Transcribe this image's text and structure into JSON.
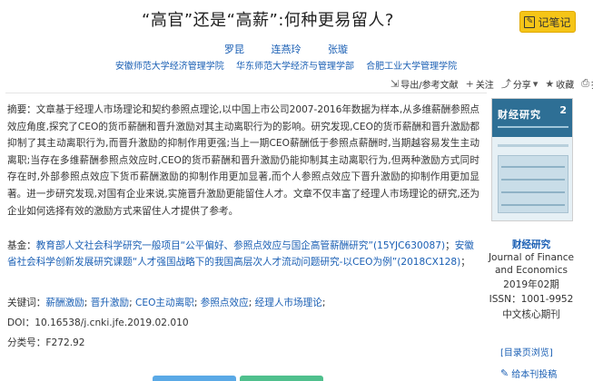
{
  "title": "“高官”还是“高薪”:何种更易留人?",
  "note_button": {
    "label": "记笔记",
    "icon": "notebook-icon"
  },
  "authors": [
    "罗昆",
    "连燕玲",
    "张璇"
  ],
  "orgs": [
    "安徽师范大学经济管理学院",
    "华东师范大学经济与管理学部",
    "合肥工业大学管理学院"
  ],
  "toolbar": {
    "export": "导出/参考文献",
    "follow": "关注",
    "share": "分享",
    "favorite": "收藏",
    "print": "打印"
  },
  "abstract": {
    "label": "摘要：",
    "text": "文章基于经理人市场理论和契约参照点理论,以中国上市公司2007-2016年数据为样本,从多维薪酬参照点效应角度,探究了CEO的货币薪酬和晋升激励对其主动离职行为的影响。研究发现,CEO的货币薪酬和晋升激励都抑制了其主动离职行为,而晋升激励的抑制作用更强;当上一期CEO薪酬低于参照点薪酬时,当期越容易发生主动离职;当存在多维薪酬参照点效应时,CEO的货币薪酬和晋升激励仍能抑制其主动离职行为,但两种激励方式同时存在时,外部参照点效应下货币薪酬激励的抑制作用更加显著,而个人参照点效应下晋升激励的抑制作用更加显著。进一步研究发现,对国有企业来说,实施晋升激励更能留住人才。文章不仅丰富了经理人市场理论的研究,还为企业如何选择有效的激励方式来留住人才提供了参考。"
  },
  "fund": {
    "label": "基金：",
    "part1": "教育部人文社会科学研究一般项目“公平偏好、参照点效应与国企高管薪酬研究”(15YJC630087)",
    "sep": "；",
    "part2": "安徽省社会科学创新发展研究课题“人才强国战略下的我国高层次人才流动问题研究-以CEO为例”(2018CX128)",
    "end": "；"
  },
  "keywords": {
    "label": "关键词：",
    "items": [
      "薪酬激励",
      "晋升激励",
      "CEO主动离职",
      "参照点效应",
      "经理人市场理论"
    ]
  },
  "doi": {
    "label": "DOI：",
    "value": "10.16538/j.cnki.jfe.2019.02.010"
  },
  "classification": {
    "label": "分类号：",
    "value": "F272.92"
  },
  "journal": {
    "cover_title": "财经研究",
    "cover_number": "2",
    "name": "财经研究",
    "english": "Journal of Finance and Economics",
    "issue": "2019年02期",
    "issn": "ISSN：1001-9952",
    "core": "中文核心期刊"
  },
  "side_links": {
    "catalog": "[目录页浏览]",
    "feedback": "给本刊投稿"
  },
  "colors": {
    "link": "#1a5fb4",
    "note_button": "#f5c518",
    "cover": "#2e6f95"
  }
}
